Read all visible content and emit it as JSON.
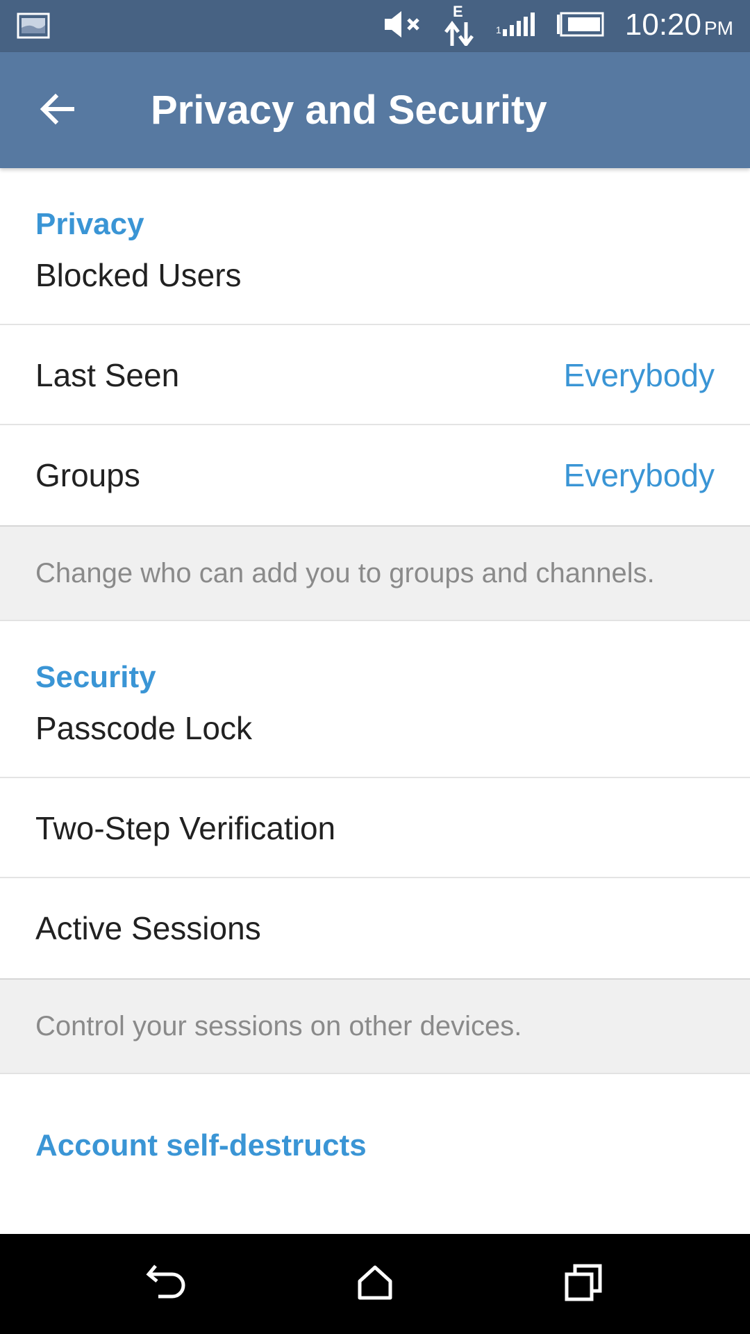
{
  "status_bar": {
    "time": "10:20",
    "ampm": "PM",
    "icons": [
      "screenshot-thumbnail-icon",
      "mute-icon",
      "data-edge-icon",
      "signal-icon",
      "battery-icon"
    ]
  },
  "app_bar": {
    "title": "Privacy and Security",
    "back_icon": "back-arrow-icon",
    "background": "#5779a1"
  },
  "sections": {
    "privacy": {
      "header": "Privacy",
      "items": [
        {
          "label": "Blocked Users",
          "value": ""
        },
        {
          "label": "Last Seen",
          "value": "Everybody"
        },
        {
          "label": "Groups",
          "value": "Everybody"
        }
      ],
      "info": "Change who can add you to groups and channels."
    },
    "security": {
      "header": "Security",
      "items": [
        {
          "label": "Passcode Lock"
        },
        {
          "label": "Two-Step Verification"
        },
        {
          "label": "Active Sessions"
        }
      ],
      "info": "Control your sessions on other devices."
    },
    "account": {
      "header": "Account self-destructs"
    }
  },
  "nav_bar": {
    "icons": [
      "nav-back-icon",
      "nav-home-icon",
      "nav-recents-icon"
    ]
  },
  "colors": {
    "accent": "#3a95d5",
    "status_bar": "#476283",
    "text_primary": "#212121",
    "text_secondary": "#8a8a8a"
  }
}
